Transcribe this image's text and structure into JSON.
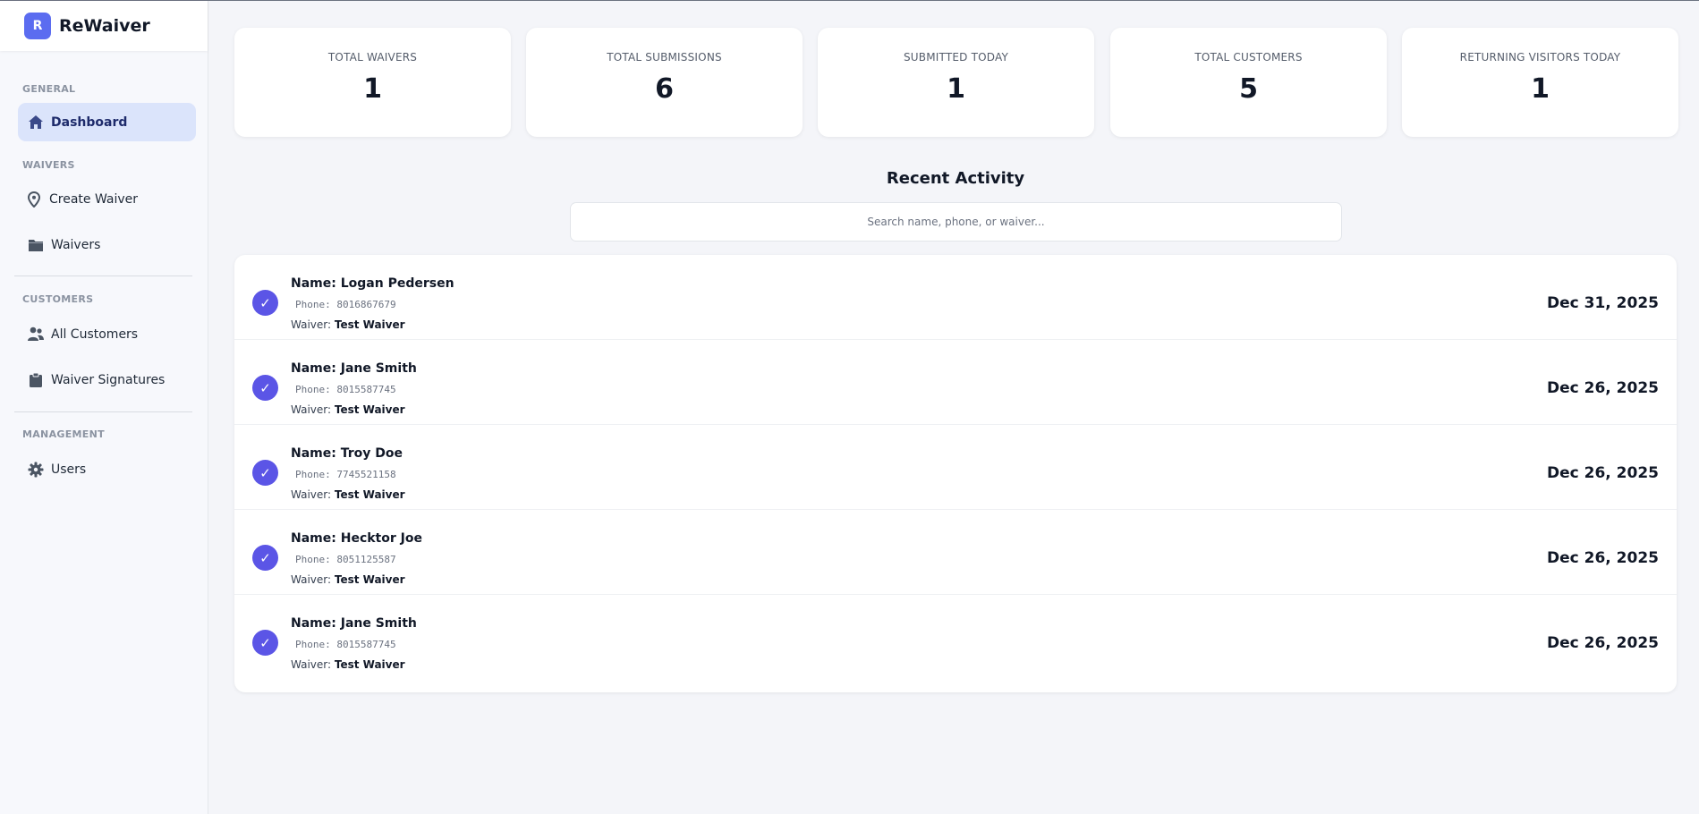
{
  "brand": {
    "logo_letter": "R",
    "name": "ReWaiver"
  },
  "sidebar": {
    "sections": [
      {
        "label": "GENERAL",
        "items": [
          {
            "label": "Dashboard",
            "icon": "home-icon",
            "active": true
          }
        ]
      },
      {
        "label": "WAIVERS",
        "items": [
          {
            "label": "Create Waiver",
            "icon": "map-pin-icon"
          },
          {
            "label": "Waivers",
            "icon": "folder-icon"
          }
        ]
      },
      {
        "label": "CUSTOMERS",
        "items": [
          {
            "label": "All Customers",
            "icon": "users-icon"
          },
          {
            "label": "Waiver Signatures",
            "icon": "clipboard-icon"
          }
        ]
      },
      {
        "label": "MANAGEMENT",
        "items": [
          {
            "label": "Users",
            "icon": "gear-icon"
          }
        ]
      }
    ]
  },
  "stats": [
    {
      "label": "TOTAL WAIVERS",
      "value": "1"
    },
    {
      "label": "TOTAL SUBMISSIONS",
      "value": "6"
    },
    {
      "label": "SUBMITTED TODAY",
      "value": "1"
    },
    {
      "label": "TOTAL CUSTOMERS",
      "value": "5"
    },
    {
      "label": "RETURNING VISITORS TODAY",
      "value": "1"
    }
  ],
  "activity": {
    "title": "Recent Activity",
    "search_placeholder": "Search name, phone, or waiver...",
    "name_prefix": "Name: ",
    "phone_prefix": "Phone: ",
    "waiver_prefix": "Waiver: ",
    "rows": [
      {
        "name": "Logan Pedersen",
        "phone": "8016867679",
        "waiver": "Test Waiver",
        "date": "Dec 31, 2025"
      },
      {
        "name": "Jane Smith",
        "phone": "8015587745",
        "waiver": "Test Waiver",
        "date": "Dec 26, 2025"
      },
      {
        "name": "Troy Doe",
        "phone": "7745521158",
        "waiver": "Test Waiver",
        "date": "Dec 26, 2025"
      },
      {
        "name": "Hecktor Joe",
        "phone": "8051125587",
        "waiver": "Test Waiver",
        "date": "Dec 26, 2025"
      },
      {
        "name": "Jane Smith",
        "phone": "8015587745",
        "waiver": "Test Waiver",
        "date": "Dec 26, 2025"
      }
    ]
  },
  "colors": {
    "accent": "#5b6cf0",
    "check": "#5b55e6",
    "active_bg": "#dbe4fb"
  }
}
